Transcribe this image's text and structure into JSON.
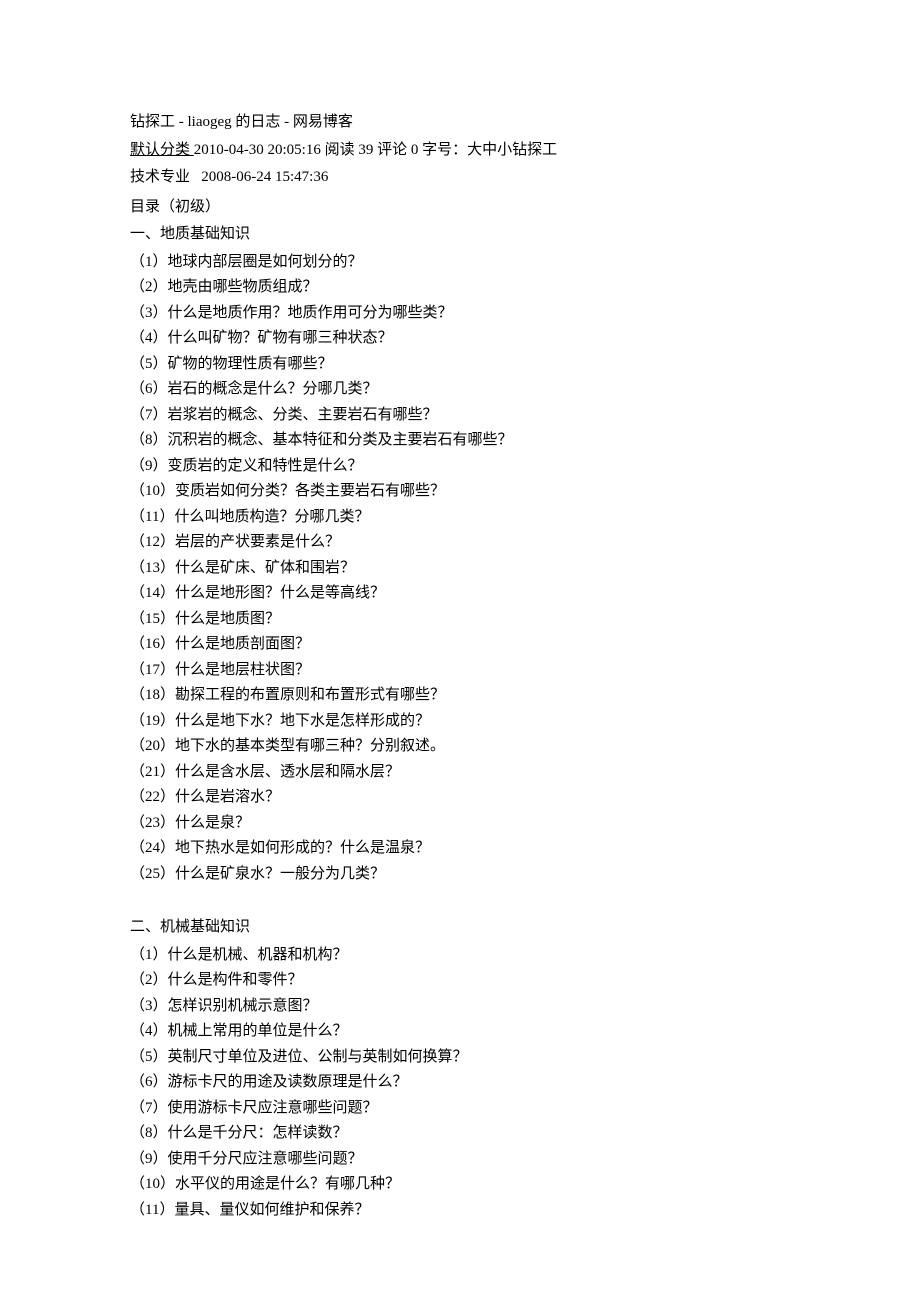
{
  "header": {
    "title": "钻探工   - liaogeg 的日志   - 网易博客"
  },
  "meta": {
    "category_link": "默认分类 ",
    "datetime": "2010-04-30 20:05:16 ",
    "read_label": "阅读 ",
    "read_count": "39 ",
    "comment_label": "评论 ",
    "comment_count": "0 ",
    "font_label": "字号：",
    "font_sizes": "大中小",
    "topic": "钻探工"
  },
  "tech": {
    "label": "技术专业",
    "datetime": "2008-06-24 15:47:36"
  },
  "toc_title": "目录（初级）",
  "section1": {
    "title": "一、地质基础知识",
    "items": [
      "（1）地球内部层圈是如何划分的？",
      "（2）地壳由哪些物质组成？",
      "（3）什么是地质作用？地质作用可分为哪些类？",
      "（4）什么叫矿物？矿物有哪三种状态？",
      "（5）矿物的物理性质有哪些？",
      "（6）岩石的概念是什么？分哪几类？",
      "（7）岩浆岩的概念、分类、主要岩石有哪些？",
      "（8）沉积岩的概念、基本特征和分类及主要岩石有哪些？",
      "（9）变质岩的定义和特性是什么？",
      "（10）变质岩如何分类？各类主要岩石有哪些？",
      "（11）什么叫地质构造？分哪几类？",
      "（12）岩层的产状要素是什么？",
      "（13）什么是矿床、矿体和围岩？",
      "（14）什么是地形图？什么是等高线？",
      "（15）什么是地质图？",
      "（16）什么是地质剖面图？",
      "（17）什么是地层柱状图？",
      "（18）勘探工程的布置原则和布置形式有哪些？",
      "（19）什么是地下水？地下水是怎样形成的？",
      "（20）地下水的基本类型有哪三种？分别叙述。",
      "（21）什么是含水层、透水层和隔水层？",
      "（22）什么是岩溶水？",
      "（23）什么是泉？",
      "（24）地下热水是如何形成的？什么是温泉？",
      "（25）什么是矿泉水？一般分为几类？"
    ]
  },
  "section2": {
    "title": "二、机械基础知识",
    "items": [
      "（1）什么是机械、机器和机构？",
      "（2）什么是构件和零件？",
      "（3）怎样识别机械示意图？",
      "（4）机械上常用的单位是什么？",
      "（5）英制尺寸单位及进位、公制与英制如何换算？",
      "（6）游标卡尺的用途及读数原理是什么？",
      "（7）使用游标卡尺应注意哪些问题？",
      "（8）什么是千分尺：怎样读数？",
      "（9）使用千分尺应注意哪些问题？",
      "（10）水平仪的用途是什么？有哪几种？",
      "（11）量具、量仪如何维护和保养？"
    ]
  }
}
